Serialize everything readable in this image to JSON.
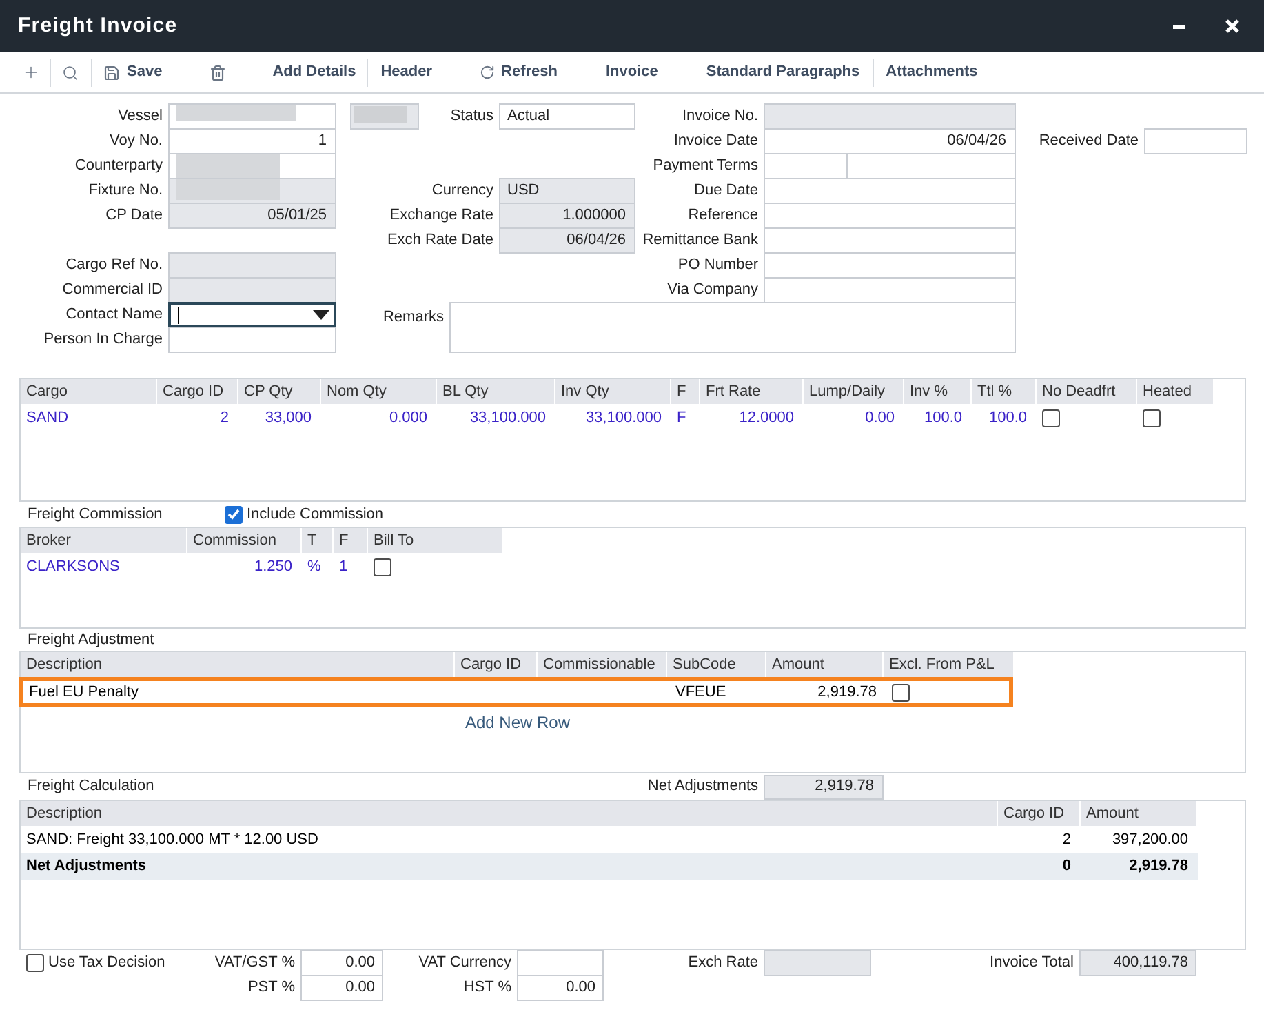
{
  "window": {
    "title": "Freight Invoice"
  },
  "toolbar": {
    "buttons": [
      {
        "label": "Save"
      },
      {
        "label": "Add Details"
      },
      {
        "label": "Header"
      },
      {
        "label": "Refresh"
      },
      {
        "label": "Invoice"
      },
      {
        "label": "Standard Paragraphs"
      },
      {
        "label": "Attachments"
      }
    ]
  },
  "header": {
    "column_1": [
      [
        {
          "label": "Vessel",
          "kind": "text",
          "readonly": false,
          "redacted": true,
          "focused": false
        },
        {
          "label": "Voy No.",
          "value": "1",
          "kind": "number",
          "readonly": false,
          "redacted": false,
          "focused": false
        },
        {
          "label": "Counterparty",
          "kind": "text",
          "readonly": false,
          "redacted": true,
          "focused": false
        },
        {
          "label": "Fixture No.",
          "kind": "text",
          "readonly": true,
          "redacted": true,
          "focused": false
        },
        {
          "label": "CP Date",
          "value": "05/01/25",
          "kind": "number",
          "readonly": true,
          "redacted": false,
          "focused": false
        }
      ],
      [
        {
          "label": "Cargo Ref No.",
          "kind": "text",
          "readonly": true,
          "redacted": false,
          "focused": false
        },
        {
          "label": "Commercial ID",
          "kind": "text",
          "readonly": true,
          "redacted": false,
          "focused": false
        },
        {
          "label": "Contact Name",
          "kind": "dropdown",
          "readonly": false,
          "redacted": false,
          "focused": true
        },
        {
          "label": "Person In Charge",
          "kind": "text",
          "readonly": false,
          "redacted": false,
          "focused": false
        }
      ]
    ],
    "vessel_code": {
      "readonly": true,
      "redacted": true
    },
    "column_2": [
      [
        {
          "label": "Status",
          "value": "Actual",
          "kind": "text",
          "readonly": false
        }
      ],
      [
        {
          "label": "Currency",
          "value": "USD",
          "kind": "text",
          "readonly": true
        },
        {
          "label": "Exchange Rate",
          "value": "1.000000",
          "kind": "number",
          "readonly": true
        },
        {
          "label": "Exch Rate Date",
          "value": "06/04/26",
          "kind": "number",
          "readonly": true
        }
      ]
    ],
    "column_3": [
      {
        "label": "Invoice No.",
        "kind": "text",
        "readonly": true
      },
      {
        "label": "Invoice Date",
        "value": "06/04/26",
        "kind": "number",
        "readonly": false
      },
      {
        "label": "Payment Terms",
        "kind": "split",
        "readonly": false
      },
      {
        "label": "Due Date",
        "kind": "text",
        "readonly": false
      },
      {
        "label": "Reference",
        "kind": "text",
        "readonly": false
      },
      {
        "label": "Remittance Bank",
        "kind": "text",
        "readonly": false
      },
      {
        "label": "PO Number",
        "kind": "text",
        "readonly": false
      },
      {
        "label": "Via Company",
        "kind": "text",
        "readonly": false
      }
    ],
    "remarks": {
      "label": "Remarks"
    },
    "received_date": {
      "label": "Received Date",
      "readonly": false
    }
  },
  "cargo_table": {
    "columns": [
      "Cargo",
      "Cargo ID",
      "CP Qty",
      "Nom Qty",
      "BL Qty",
      "Inv Qty",
      "F",
      "Frt Rate",
      "Lump/Daily",
      "Inv %",
      "Ttl %",
      "No Deadfrt",
      "Heated"
    ],
    "rows": [
      {
        "cells": [
          {
            "kind": "text",
            "text": "SAND"
          },
          {
            "kind": "number",
            "text": "2"
          },
          {
            "kind": "number",
            "text": "33,000"
          },
          {
            "kind": "number",
            "text": "0.000"
          },
          {
            "kind": "number",
            "text": "33,100.000"
          },
          {
            "kind": "number",
            "text": "33,100.000"
          },
          {
            "kind": "text",
            "text": "F"
          },
          {
            "kind": "number",
            "text": "12.0000"
          },
          {
            "kind": "number",
            "text": "0.00"
          },
          {
            "kind": "number",
            "text": "100.0"
          },
          {
            "kind": "number",
            "text": "100.0"
          },
          {
            "kind": "checkbox",
            "checked": false
          },
          {
            "kind": "checkbox",
            "checked": false
          }
        ]
      }
    ]
  },
  "freight_commission": {
    "title": "Freight Commission",
    "include_commission": {
      "label": "Include Commission",
      "checked": true
    },
    "columns": [
      "Broker",
      "Commission",
      "T",
      "F",
      "Bill To"
    ],
    "rows": [
      {
        "cells": [
          {
            "kind": "text",
            "text": "CLARKSONS"
          },
          {
            "kind": "number",
            "text": "1.250"
          },
          {
            "kind": "text",
            "text": "%"
          },
          {
            "kind": "text",
            "text": "1"
          },
          {
            "kind": "checkbox",
            "checked": false
          }
        ]
      }
    ]
  },
  "freight_adjustment": {
    "title": "Freight Adjustment",
    "columns": [
      "Description",
      "Cargo ID",
      "Commissionable",
      "SubCode",
      "Amount",
      "Excl. From P&L"
    ],
    "rows": [
      {
        "highlighted": true,
        "cells": [
          {
            "kind": "text",
            "text": "Fuel EU Penalty"
          },
          {
            "kind": "empty"
          },
          {
            "kind": "empty"
          },
          {
            "kind": "text",
            "text": "VFEUE"
          },
          {
            "kind": "number",
            "text": "2,919.78"
          },
          {
            "kind": "checkbox",
            "checked": false
          }
        ]
      }
    ],
    "add_row": "Add New Row"
  },
  "freight_calculation": {
    "title": "Freight Calculation",
    "net_adjustments": {
      "label": "Net Adjustments",
      "value": "2,919.78",
      "readonly": true
    },
    "columns": [
      "Description",
      "Cargo ID",
      "Amount"
    ],
    "rows": [
      {
        "kind": "detail",
        "cells": [
          {
            "kind": "text",
            "text": "SAND: Freight 33,100.000 MT * 12.00 USD"
          },
          {
            "kind": "number",
            "text": "2"
          },
          {
            "kind": "number",
            "text": "397,200.00"
          }
        ]
      },
      {
        "kind": "total",
        "cells": [
          {
            "kind": "text",
            "text": "Net Adjustments"
          },
          {
            "kind": "number",
            "text": "0"
          },
          {
            "kind": "number",
            "text": "2,919.78"
          }
        ]
      }
    ]
  },
  "tax": {
    "use_tax_decision": {
      "label": "Use Tax Decision",
      "checked": false
    },
    "rows": [
      [
        {
          "label": "VAT/GST %",
          "value": "0.00",
          "readonly": false
        },
        {
          "label": "VAT Currency",
          "readonly": false
        },
        {
          "label": "Exch Rate",
          "readonly": true
        },
        {
          "label": "Invoice Total",
          "value": "400,119.78",
          "readonly": true
        }
      ],
      [
        {
          "label": "PST %",
          "value": "0.00",
          "readonly": false
        },
        {
          "label": "HST %",
          "value": "0.00",
          "readonly": false
        }
      ]
    ]
  }
}
